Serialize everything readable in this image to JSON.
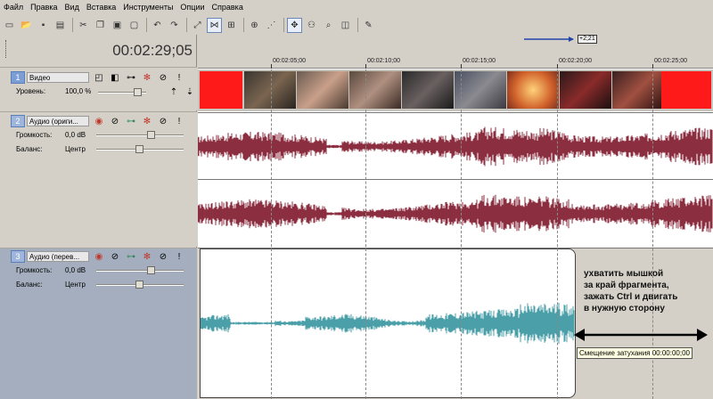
{
  "menu": [
    "Файл",
    "Правка",
    "Вид",
    "Вставка",
    "Инструменты",
    "Опции",
    "Справка"
  ],
  "toolbar_icons": [
    "new-icon",
    "open-icon",
    "save-icon",
    "properties-icon",
    "cut-icon",
    "copy-icon",
    "paste-icon",
    "delete-icon",
    "undo-icon",
    "redo-icon",
    "normal-edit-tool-icon",
    "envelope-tool-icon",
    "selection-tool-icon",
    "snapping-icon",
    "auto-crossfade-icon",
    "lock-envelopes-icon",
    "ignore-grouping-icon",
    "zoom-icon",
    "properties-icon-2"
  ],
  "timecode": "00:02:29;05",
  "ruler": {
    "labels": [
      "00:02:05;00",
      "00:02:10;00",
      "00:02:15;00",
      "00:02:20;00",
      "00:02:25;00"
    ],
    "marker": "+2;21"
  },
  "tracks": [
    {
      "num": "1",
      "name": "Видео",
      "param1_label": "Уровень:",
      "param1_value": "100,0 %"
    },
    {
      "num": "2",
      "name": "Аудио (ориги...",
      "param1_label": "Громкость:",
      "param1_value": "0,0 dB",
      "param2_label": "Баланс:",
      "param2_value": "Центр"
    },
    {
      "num": "3",
      "name": "Аудио (перев...",
      "param1_label": "Громкость:",
      "param1_value": "0,0 dB",
      "param2_label": "Баланс:",
      "param2_value": "Центр"
    }
  ],
  "annotation": [
    "ухватить мышкой",
    "за край фрагмента,",
    "зажать Ctrl и двигать",
    "в нужную сторону"
  ],
  "tooltip": "Смещение затухания 00:00:00;00",
  "colors": {
    "waveform_orig": "#8b2e3f",
    "waveform_trans": "#4a9fa8",
    "video_bg": "#ff1a1a",
    "selected_track": "#a4aebe"
  }
}
